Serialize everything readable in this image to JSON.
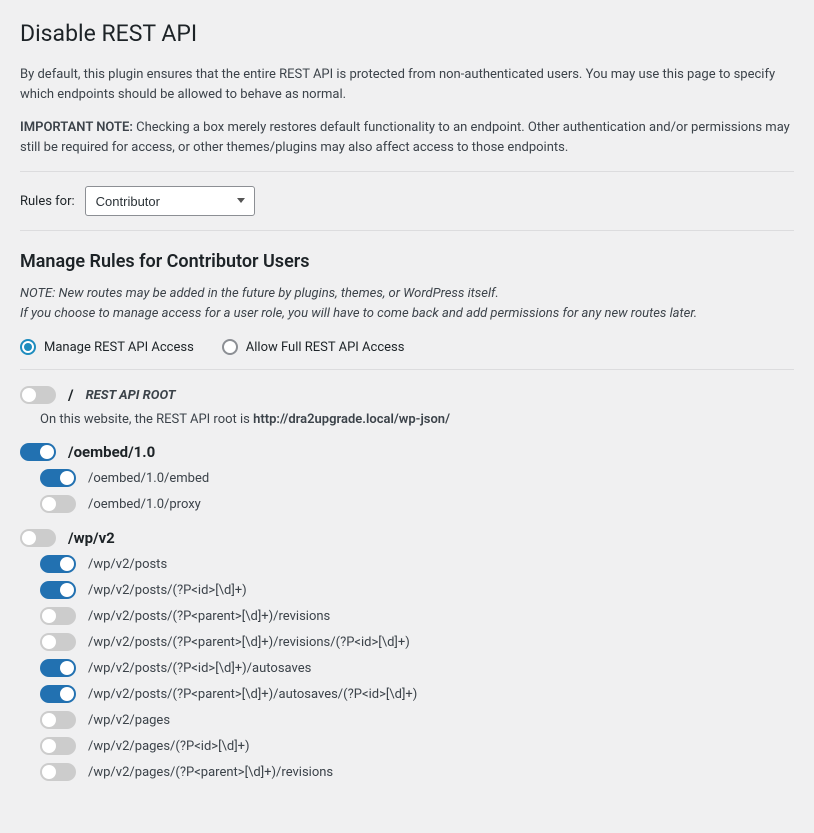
{
  "title": "Disable REST API",
  "intro": "By default, this plugin ensures that the entire REST API is protected from non-authenticated users. You may use this page to specify which endpoints should be allowed to behave as normal.",
  "important_label": "IMPORTANT NOTE:",
  "important_text": " Checking a box merely restores default functionality to an endpoint. Other authentication and/or permissions may still be required for access, or other themes/plugins may also affect access to those endpoints.",
  "rules_for_label": "Rules for:",
  "role_selected": "Contributor",
  "manage_heading": "Manage Rules for Contributor Users",
  "subnote_line1": "NOTE: New routes may be added in the future by plugins, themes, or WordPress itself.",
  "subnote_line2": "If you choose to manage access for a user role, you will have to come back and add permissions for any new routes later.",
  "radio_manage": "Manage REST API Access",
  "radio_full": "Allow Full REST API Access",
  "root": {
    "slash": "/",
    "label": "REST API ROOT",
    "desc_prefix": "On this website, the REST API root is ",
    "desc_url": "http://dra2upgrade.local/wp-json/"
  },
  "groups": [
    {
      "name": "/oembed/1.0",
      "on": true,
      "routes": [
        {
          "path": "/oembed/1.0/embed",
          "on": true
        },
        {
          "path": "/oembed/1.0/proxy",
          "on": false
        }
      ]
    },
    {
      "name": "/wp/v2",
      "on": false,
      "routes": [
        {
          "path": "/wp/v2/posts",
          "on": true
        },
        {
          "path": "/wp/v2/posts/(?P<id>[\\d]+)",
          "on": true
        },
        {
          "path": "/wp/v2/posts/(?P<parent>[\\d]+)/revisions",
          "on": false
        },
        {
          "path": "/wp/v2/posts/(?P<parent>[\\d]+)/revisions/(?P<id>[\\d]+)",
          "on": false
        },
        {
          "path": "/wp/v2/posts/(?P<id>[\\d]+)/autosaves",
          "on": true
        },
        {
          "path": "/wp/v2/posts/(?P<parent>[\\d]+)/autosaves/(?P<id>[\\d]+)",
          "on": true
        },
        {
          "path": "/wp/v2/pages",
          "on": false
        },
        {
          "path": "/wp/v2/pages/(?P<id>[\\d]+)",
          "on": false
        },
        {
          "path": "/wp/v2/pages/(?P<parent>[\\d]+)/revisions",
          "on": false
        }
      ]
    }
  ]
}
